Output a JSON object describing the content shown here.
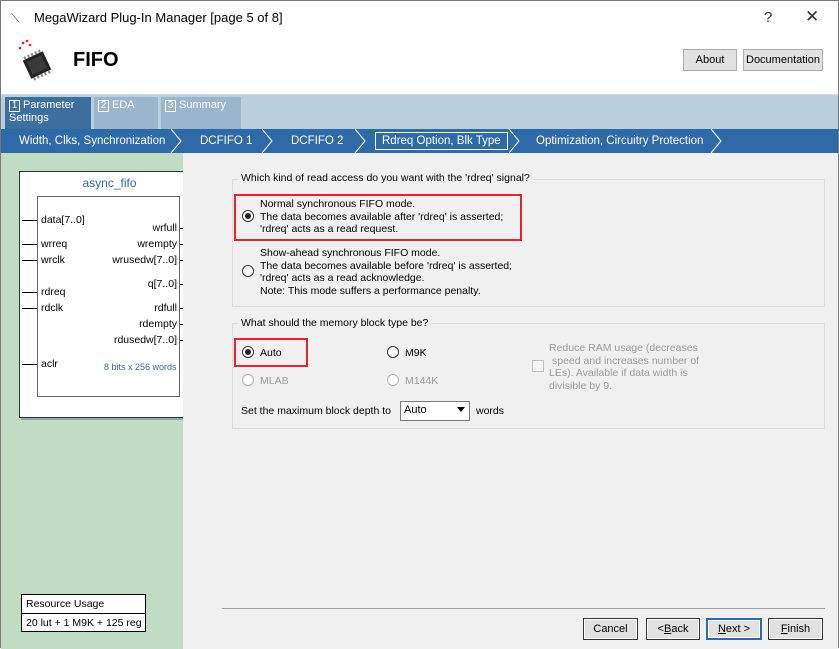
{
  "window": {
    "title": "MegaWizard Plug-In Manager [page 5 of 8]",
    "help": "?",
    "close": "✕"
  },
  "header": {
    "component": "FIFO",
    "about": "About",
    "documentation": "Documentation"
  },
  "tabs": [
    {
      "num": "1",
      "label": "Parameter Settings"
    },
    {
      "num": "2",
      "label": "EDA"
    },
    {
      "num": "3",
      "label": "Summary"
    }
  ],
  "steps": [
    "Width, Clks, Synchronization",
    "DCFIFO 1",
    "DCFIFO 2",
    "Rdreq Option, Blk Type",
    "Optimization, Circuitry Protection"
  ],
  "symbol": {
    "name": "async_fifo",
    "inputs": [
      "data[7..0]",
      "wrreq",
      "wrclk",
      "rdreq",
      "rdclk",
      "aclr"
    ],
    "outputs": [
      "wrfull",
      "wrempty",
      "wrusedw[7..0]",
      "q[7..0]",
      "rdfull",
      "rdempty",
      "rdusedw[7..0]"
    ],
    "size_note": "8 bits x 256 words"
  },
  "resource": {
    "title": "Resource Usage",
    "value": "20 lut + 1 M9K + 125 reg"
  },
  "read_access": {
    "question": "Which kind of read access do you want with the 'rdreq' signal?",
    "normal": [
      "Normal synchronous FIFO mode.",
      "The data becomes available after 'rdreq' is asserted;",
      "'rdreq' acts as a read request."
    ],
    "showahead": [
      "Show-ahead synchronous FIFO mode.",
      "The data becomes available before 'rdreq' is asserted;",
      "'rdreq' acts as a read acknowledge.",
      "Note: This mode suffers a performance penalty."
    ],
    "selected": "normal"
  },
  "memory": {
    "question": "What should the memory block type be?",
    "auto": "Auto",
    "m9k": "M9K",
    "mlab": "MLAB",
    "m144k": "M144K",
    "reduce": [
      "Reduce RAM usage (decreases",
      "speed and increases number of",
      "LEs).  Available if data width is",
      "divisible by 9."
    ],
    "depth_label": "Set the maximum block depth to",
    "depth_value": "Auto",
    "depth_unit": "words",
    "selected": "auto"
  },
  "buttons": {
    "cancel": "Cancel",
    "back_pre": "< ",
    "back_u": "B",
    "back_post": "ack",
    "next_u": "N",
    "next_post": "ext >",
    "finish_u": "F",
    "finish_post": "inish"
  }
}
